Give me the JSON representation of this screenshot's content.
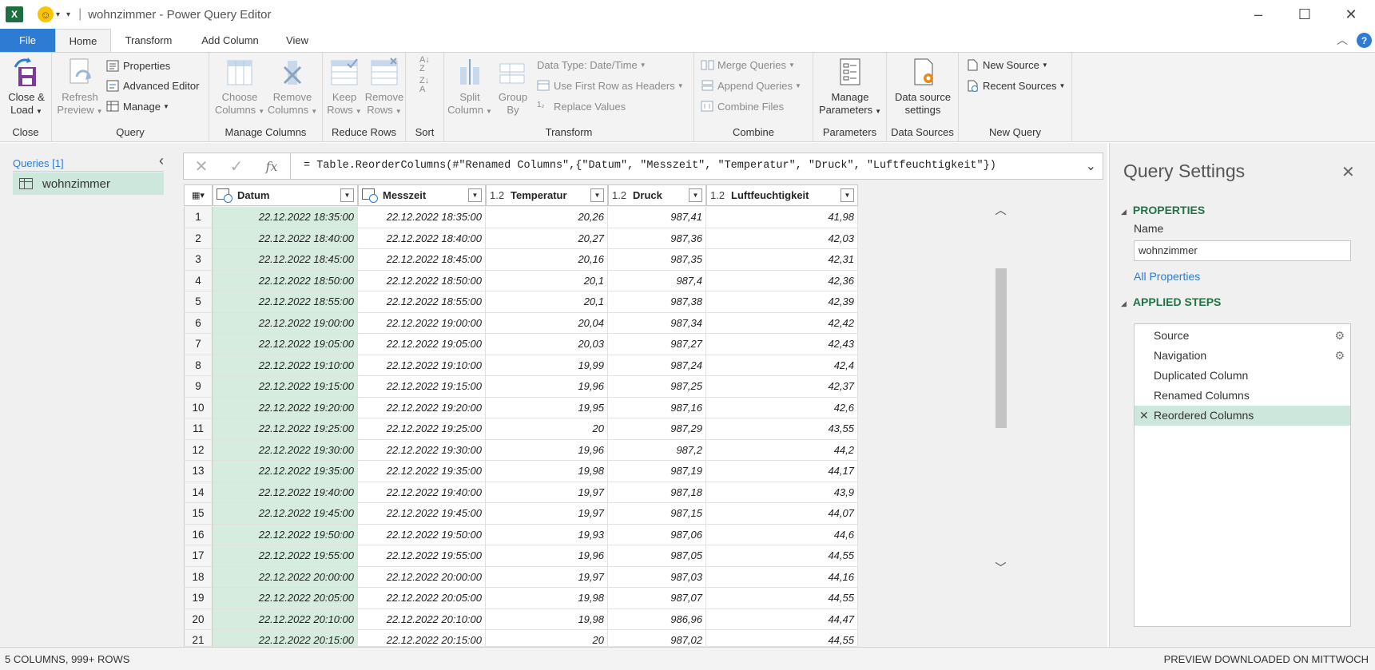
{
  "window": {
    "title": "wohnzimmer - Power Query Editor",
    "app_icon": "excel-icon",
    "quick_access": "smiley-icon"
  },
  "tabs": [
    "File",
    "Home",
    "Transform",
    "Add Column",
    "View"
  ],
  "ribbon": {
    "close": {
      "label": "Close &",
      "label2": "Load",
      "group": "Close"
    },
    "query": {
      "refresh": "Refresh",
      "refresh2": "Preview",
      "properties": "Properties",
      "advanced_editor": "Advanced Editor",
      "manage": "Manage",
      "group": "Query"
    },
    "manage_columns": {
      "choose": "Choose",
      "choose2": "Columns",
      "remove": "Remove",
      "remove2": "Columns",
      "group": "Manage Columns"
    },
    "reduce_rows": {
      "keep": "Keep",
      "keep2": "Rows",
      "remove": "Remove",
      "remove2": "Rows",
      "group": "Reduce Rows"
    },
    "sort": {
      "group": "Sort"
    },
    "transform": {
      "split": "Split",
      "split2": "Column",
      "group_by": "Group",
      "group_by2": "By",
      "data_type": "Data Type: Date/Time",
      "first_row": "Use First Row as Headers",
      "replace": "Replace Values",
      "group": "Transform"
    },
    "combine": {
      "merge": "Merge Queries",
      "append": "Append Queries",
      "combine_files": "Combine Files",
      "group": "Combine"
    },
    "parameters": {
      "manage": "Manage",
      "manage2": "Parameters",
      "group": "Parameters"
    },
    "data_sources": {
      "settings": "Data source",
      "settings2": "settings",
      "group": "Data Sources"
    },
    "new_query": {
      "new_source": "New Source",
      "recent_sources": "Recent Sources",
      "group": "New Query"
    }
  },
  "queries_pane": {
    "title": "Queries [1]",
    "items": [
      {
        "label": "wohnzimmer"
      }
    ]
  },
  "formula": "= Table.ReorderColumns(#\"Renamed Columns\",{\"Datum\", \"Messzeit\", \"Temperatur\", \"Druck\", \"Luftfeuchtigkeit\"})",
  "grid": {
    "columns": [
      {
        "type": "datetime",
        "name": "Datum"
      },
      {
        "type": "datetime",
        "name": "Messzeit"
      },
      {
        "type": "1.2",
        "name": "Temperatur"
      },
      {
        "type": "1.2",
        "name": "Druck"
      },
      {
        "type": "1.2",
        "name": "Luftfeuchtigkeit"
      }
    ],
    "rows": [
      [
        "1",
        "22.12.2022 18:35:00",
        "22.12.2022 18:35:00",
        "20,26",
        "987,41",
        "41,98"
      ],
      [
        "2",
        "22.12.2022 18:40:00",
        "22.12.2022 18:40:00",
        "20,27",
        "987,36",
        "42,03"
      ],
      [
        "3",
        "22.12.2022 18:45:00",
        "22.12.2022 18:45:00",
        "20,16",
        "987,35",
        "42,31"
      ],
      [
        "4",
        "22.12.2022 18:50:00",
        "22.12.2022 18:50:00",
        "20,1",
        "987,4",
        "42,36"
      ],
      [
        "5",
        "22.12.2022 18:55:00",
        "22.12.2022 18:55:00",
        "20,1",
        "987,38",
        "42,39"
      ],
      [
        "6",
        "22.12.2022 19:00:00",
        "22.12.2022 19:00:00",
        "20,04",
        "987,34",
        "42,42"
      ],
      [
        "7",
        "22.12.2022 19:05:00",
        "22.12.2022 19:05:00",
        "20,03",
        "987,27",
        "42,43"
      ],
      [
        "8",
        "22.12.2022 19:10:00",
        "22.12.2022 19:10:00",
        "19,99",
        "987,24",
        "42,4"
      ],
      [
        "9",
        "22.12.2022 19:15:00",
        "22.12.2022 19:15:00",
        "19,96",
        "987,25",
        "42,37"
      ],
      [
        "10",
        "22.12.2022 19:20:00",
        "22.12.2022 19:20:00",
        "19,95",
        "987,16",
        "42,6"
      ],
      [
        "11",
        "22.12.2022 19:25:00",
        "22.12.2022 19:25:00",
        "20",
        "987,29",
        "43,55"
      ],
      [
        "12",
        "22.12.2022 19:30:00",
        "22.12.2022 19:30:00",
        "19,96",
        "987,2",
        "44,2"
      ],
      [
        "13",
        "22.12.2022 19:35:00",
        "22.12.2022 19:35:00",
        "19,98",
        "987,19",
        "44,17"
      ],
      [
        "14",
        "22.12.2022 19:40:00",
        "22.12.2022 19:40:00",
        "19,97",
        "987,18",
        "43,9"
      ],
      [
        "15",
        "22.12.2022 19:45:00",
        "22.12.2022 19:45:00",
        "19,97",
        "987,15",
        "44,07"
      ],
      [
        "16",
        "22.12.2022 19:50:00",
        "22.12.2022 19:50:00",
        "19,93",
        "987,06",
        "44,6"
      ],
      [
        "17",
        "22.12.2022 19:55:00",
        "22.12.2022 19:55:00",
        "19,96",
        "987,05",
        "44,55"
      ],
      [
        "18",
        "22.12.2022 20:00:00",
        "22.12.2022 20:00:00",
        "19,97",
        "987,03",
        "44,16"
      ],
      [
        "19",
        "22.12.2022 20:05:00",
        "22.12.2022 20:05:00",
        "19,98",
        "987,07",
        "44,55"
      ],
      [
        "20",
        "22.12.2022 20:10:00",
        "22.12.2022 20:10:00",
        "19,98",
        "986,96",
        "44,47"
      ],
      [
        "21",
        "22.12.2022 20:15:00",
        "22.12.2022 20:15:00",
        "20",
        "987,02",
        "44,55"
      ]
    ]
  },
  "query_settings": {
    "title": "Query Settings",
    "properties_label": "PROPERTIES",
    "name_label": "Name",
    "name_value": "wohnzimmer",
    "all_properties": "All Properties",
    "applied_steps_label": "APPLIED STEPS",
    "steps": [
      {
        "label": "Source",
        "gear": true
      },
      {
        "label": "Navigation",
        "gear": true
      },
      {
        "label": "Duplicated Column",
        "gear": false
      },
      {
        "label": "Renamed Columns",
        "gear": false
      },
      {
        "label": "Reordered Columns",
        "gear": false,
        "active": true
      }
    ]
  },
  "status": {
    "left": "5 COLUMNS, 999+ ROWS",
    "right": "PREVIEW DOWNLOADED ON MITTWOCH"
  },
  "colors": {
    "accent": "#2d7bd3",
    "selected_column": "#d5ecdf",
    "section_header": "#217346"
  }
}
